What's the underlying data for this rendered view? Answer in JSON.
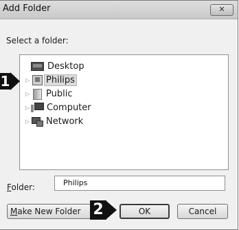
{
  "dialog": {
    "title": "Add Folder",
    "close_label": "✕",
    "prompt": "Select a folder:"
  },
  "tree": {
    "items": [
      {
        "label": "Desktop",
        "icon": "desktop-icon",
        "expandable": false,
        "selected": false
      },
      {
        "label": "Philips",
        "icon": "user-folder-icon",
        "expandable": true,
        "selected": true
      },
      {
        "label": "Public",
        "icon": "public-folder-icon",
        "expandable": true,
        "selected": false
      },
      {
        "label": "Computer",
        "icon": "computer-icon",
        "expandable": true,
        "selected": false
      },
      {
        "label": "Network",
        "icon": "network-icon",
        "expandable": true,
        "selected": false
      }
    ],
    "expand_glyph": "▷"
  },
  "folder_field": {
    "label_accel": "F",
    "label_rest": "older:",
    "value": "Philips"
  },
  "buttons": {
    "new_folder_accel": "M",
    "new_folder_rest": "ake New Folder",
    "ok": "OK",
    "cancel": "Cancel"
  },
  "callouts": {
    "one": "1",
    "two": "2"
  }
}
